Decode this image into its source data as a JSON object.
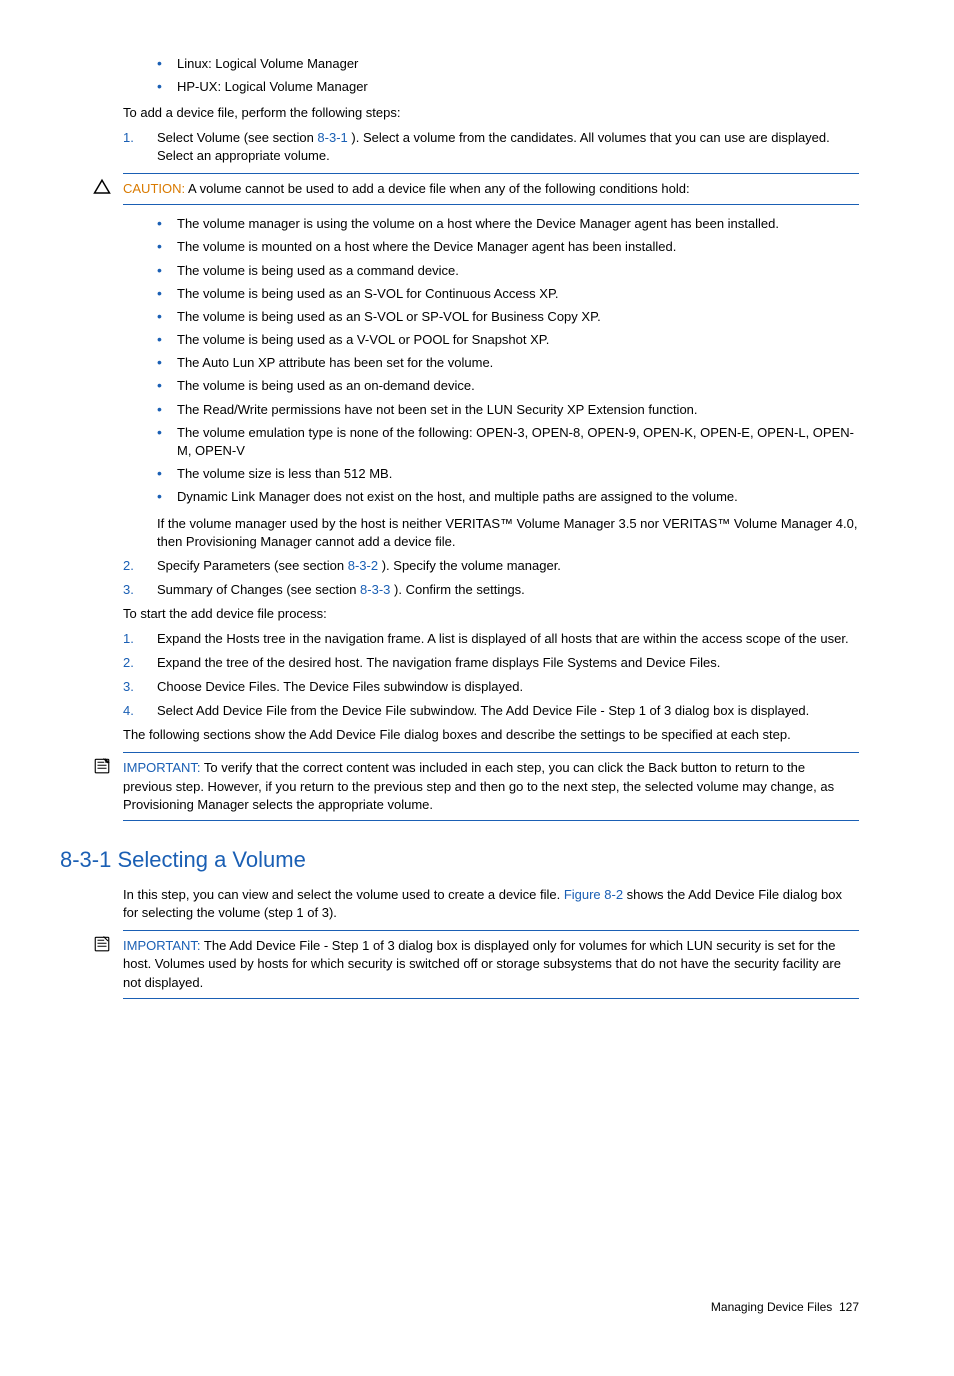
{
  "top_bullets": [
    "Linux: Logical Volume Manager",
    "HP-UX: Logical Volume Manager"
  ],
  "intro_line": "To add a device file, perform the following steps:",
  "step1": {
    "pre": "Select Volume (see section ",
    "link": "8-3-1",
    "post": " ). Select a volume from the candidates. All volumes that you can use are displayed. Select an appropriate volume."
  },
  "caution": {
    "label": "CAUTION:",
    "text": "  A volume cannot be used to add a device file when any of the following conditions hold:"
  },
  "condition_bullets": [
    "The volume manager is using the volume on a host where the Device Manager agent has been installed.",
    "The volume is mounted on a host where the Device Manager agent has been installed.",
    "The volume is being used as a command device.",
    "The volume is being used as an S-VOL for Continuous Access XP.",
    "The volume is being used as an S-VOL or SP-VOL for Business Copy XP.",
    "The volume is being used as a V-VOL or POOL for Snapshot XP.",
    "The Auto Lun XP attribute has been set for the volume.",
    "The volume is being used as an on-demand device.",
    "The Read/Write permissions have not been set in the LUN Security XP Extension function.",
    "The volume emulation type is none of the following: OPEN-3, OPEN-8, OPEN-9, OPEN-K, OPEN-E, OPEN-L, OPEN-M, OPEN-V",
    "The volume size is less than 512 MB.",
    "Dynamic Link Manager does not exist on the host, and multiple paths are assigned to the volume."
  ],
  "after_conditions": "If the volume manager used by the host is neither VERITAS™ Volume Manager 3.5 nor VERITAS™ Volume Manager 4.0, then Provisioning Manager cannot add a device file.",
  "step2": {
    "pre": "Specify Parameters (see section ",
    "link": "8-3-2",
    "post": " ). Specify the volume manager."
  },
  "step3": {
    "pre": "Summary of Changes (see section ",
    "link": "8-3-3",
    "post": " ). Confirm the settings."
  },
  "start_line": "To start the add device file process:",
  "second_steps": [
    "Expand the Hosts tree in the navigation frame. A list is displayed of all hosts that are within the access scope of the user.",
    "Expand the tree of the desired host. The navigation frame displays File Systems and Device Files.",
    "Choose Device Files. The Device Files subwindow is displayed.",
    "Select Add Device File from the Device File subwindow. The Add Device File - Step 1 of 3 dialog box is displayed."
  ],
  "following": "The following sections show the Add Device File dialog boxes and describe the settings to be specified at each step.",
  "important1": {
    "label": "IMPORTANT:",
    "text": "  To verify that the correct content was included in each step, you can click the Back button to return to the previous step. However, if you return to the previous step and then go to the next step, the selected volume may change, as Provisioning Manager selects the appropriate volume."
  },
  "heading": "8-3-1  Selecting a Volume",
  "section_body": {
    "pre": "In this step, you can view and select the volume used to create a device file. ",
    "link": "Figure 8-2",
    "post": " shows the Add Device File dialog box for selecting the volume (step 1 of 3)."
  },
  "important2": {
    "label": "IMPORTANT:",
    "text": "  The Add Device File - Step 1 of 3 dialog box is displayed only for volumes for which LUN security is set for the host. Volumes used by hosts for which security is switched off or storage subsystems that do not have the security facility are not displayed."
  },
  "footer": {
    "section": "Managing Device Files",
    "page": "127"
  }
}
